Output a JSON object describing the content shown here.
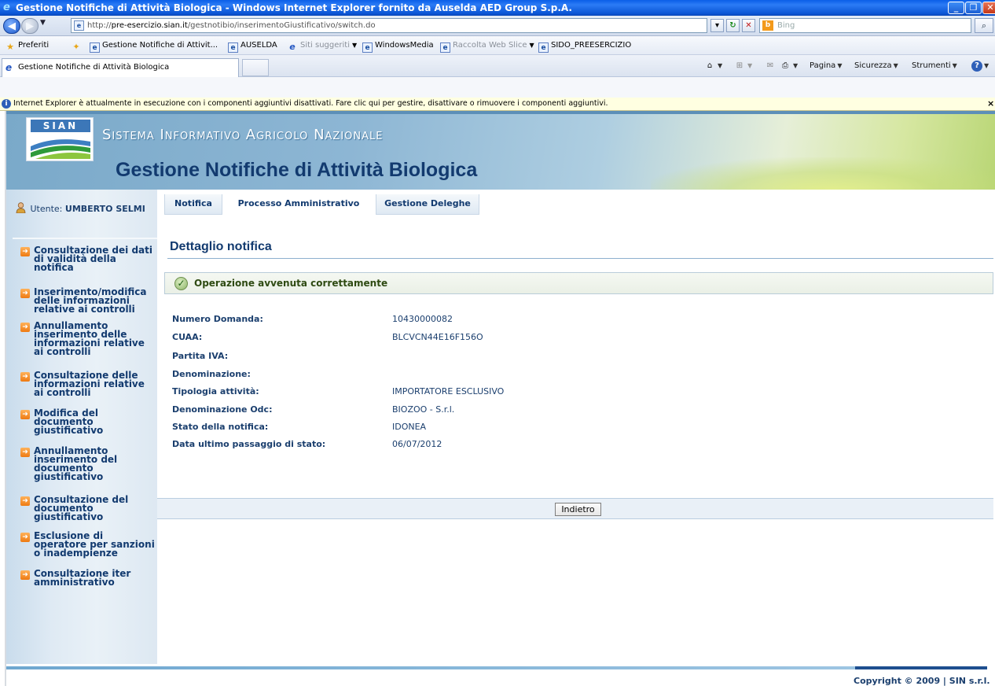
{
  "browser": {
    "window_title": "Gestione Notifiche di Attività Biologica - Windows Internet Explorer fornito da Auselda AED Group S.p.A.",
    "url_prefix": "http://",
    "url_domain": "pre-esercizio.sian.it",
    "url_path": "/gestnotibio/inserimentoGiustificativo/switch.do",
    "search_placeholder": "Bing",
    "favorites_label": "Preferiti",
    "favorites": [
      {
        "label": "Gestione Notifiche di Attivit...",
        "icon": "ie-page-icon"
      },
      {
        "label": "AUSELDA",
        "icon": "ie-page-icon"
      },
      {
        "label": "Siti suggeriti",
        "icon": "ie-logo-icon"
      },
      {
        "label": "WindowsMedia",
        "icon": "ie-page-icon"
      },
      {
        "label": "Raccolta Web Slice",
        "icon": "ie-page-icon"
      },
      {
        "label": "SIDO_PREESERCIZIO",
        "icon": "ie-page-icon"
      }
    ],
    "tab_title": "Gestione Notifiche di Attività Biologica",
    "commands": {
      "pagina": "Pagina",
      "sicurezza": "Sicurezza",
      "strumenti": "Strumenti"
    },
    "infobar_text": "Internet Explorer è attualmente in esecuzione con i componenti aggiuntivi disattivati. Fare clic qui per gestire, disattivare o rimuovere i componenti aggiuntivi.",
    "infobar_close": "×"
  },
  "header": {
    "logo_label": "SIAN",
    "system_name": "Sistema Informativo Agricolo Nazionale",
    "app_title": "Gestione Notifiche di Attività Biologica"
  },
  "user": {
    "label": "Utente:",
    "name": "UMBERTO SELMI"
  },
  "sidebar": {
    "items": [
      {
        "label": "Consultazione dei dati di validità della notifica"
      },
      {
        "label": "Inserimento/modifica delle informazioni relative ai controlli"
      },
      {
        "label": "Annullamento inserimento delle informazioni relative ai controlli"
      },
      {
        "label": "Consultazione delle informazioni relative ai controlli"
      },
      {
        "label": "Modifica del documento giustificativo"
      },
      {
        "label": "Annullamento inserimento del documento giustificativo"
      },
      {
        "label": "Consultazione del documento giustificativo"
      },
      {
        "label": "Esclusione di operatore per sanzioni o inadempienze"
      },
      {
        "label": "Consultazione iter amministrativo"
      }
    ]
  },
  "topnav": {
    "notifica": "Notifica",
    "processo": "Processo Amministrativo",
    "deleghe": "Gestione Deleghe"
  },
  "main": {
    "section_title": "Dettaglio notifica",
    "success_message": "Operazione avvenuta correttamente",
    "fields": [
      {
        "label": "Numero Domanda:",
        "value": "10430000082"
      },
      {
        "label": "CUAA:",
        "value": "BLCVCN44E16F156O"
      },
      {
        "label": "Partita IVA:",
        "value": ""
      },
      {
        "label": "Denominazione:",
        "value": ""
      },
      {
        "label": "Tipologia attività:",
        "value": "IMPORTATORE ESCLUSIVO"
      },
      {
        "label": "Denominazione Odc:",
        "value": "BIOZOO - S.r.l."
      },
      {
        "label": "Stato della notifica:",
        "value": "IDONEA"
      },
      {
        "label": "Data ultimo passaggio di stato:",
        "value": "06/07/2012"
      }
    ],
    "back_button": "Indietro"
  },
  "footer": {
    "copyright": "Copyright © 2009 | SIN s.r.l."
  }
}
